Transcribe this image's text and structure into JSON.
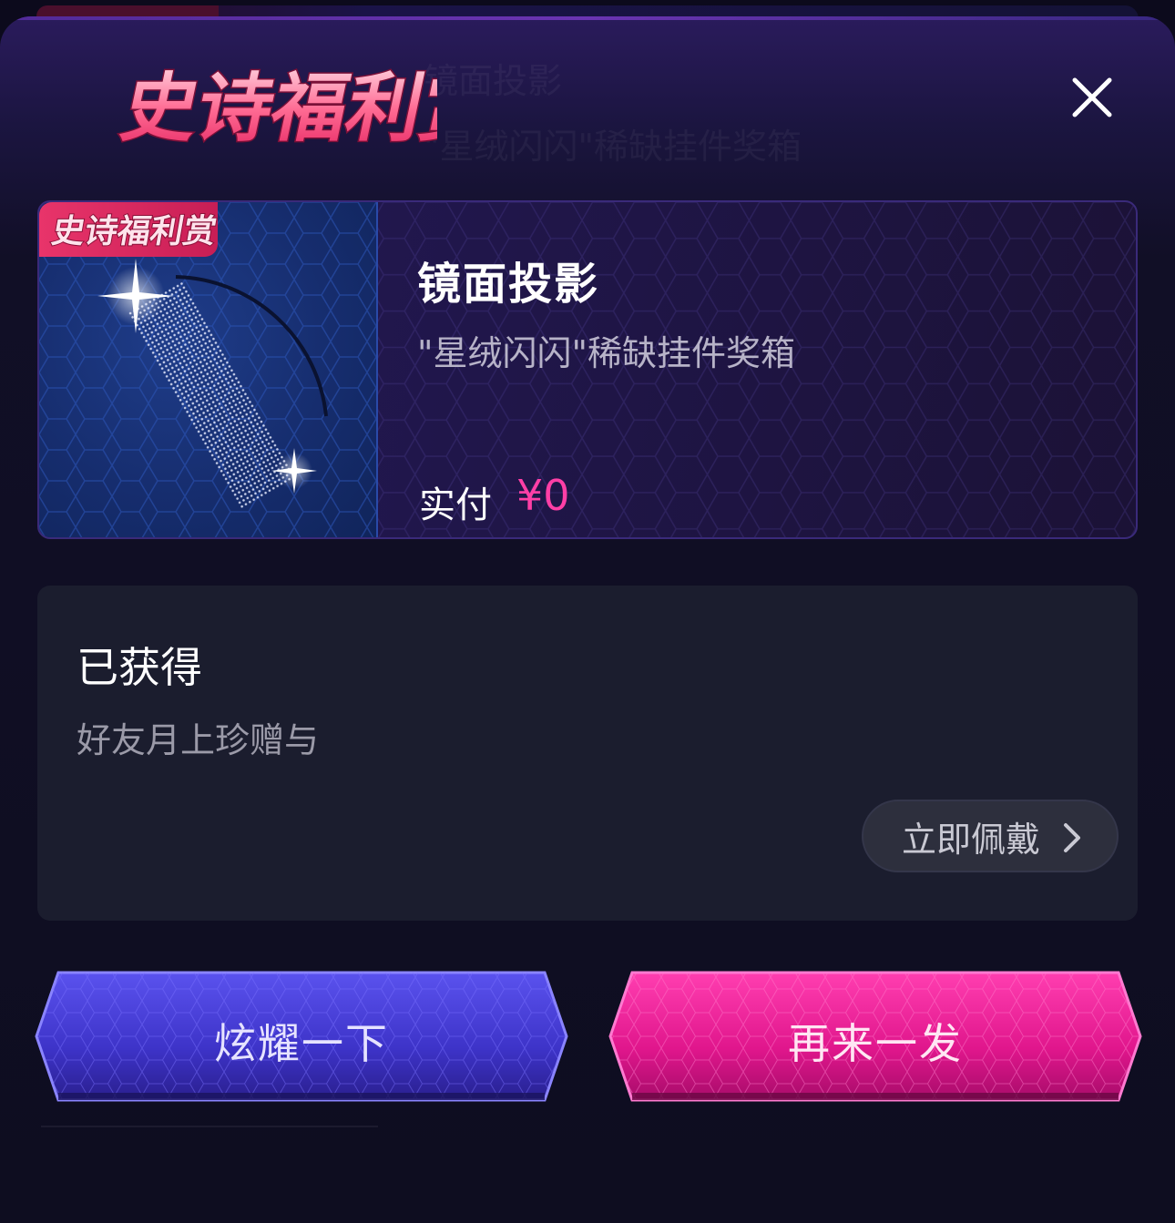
{
  "header": {
    "logo_text": "史诗福利赏",
    "close_icon": "close-icon"
  },
  "ghost": {
    "line1": "镜面投影",
    "line2": "\"星绒闪闪\"稀缺挂件奖箱"
  },
  "item_card": {
    "badge_text": "史诗福利赏",
    "title": "镜面投影",
    "subtitle": "\"星绒闪闪\"稀缺挂件奖箱",
    "pay_label": "实付",
    "pay_value": "¥0",
    "thumbnail": "sparkle-comb-image"
  },
  "obtained_panel": {
    "title": "已获得",
    "source": "好友月上珍赠与",
    "wear_button": "立即佩戴",
    "wear_icon": "chevron-right-icon"
  },
  "actions": {
    "show_off": "炫耀一下",
    "again": "再来一发"
  },
  "colors": {
    "accent_pink": "#ff3fa6",
    "button_blue": "#4a3fd6",
    "button_pink": "#e01e96"
  }
}
